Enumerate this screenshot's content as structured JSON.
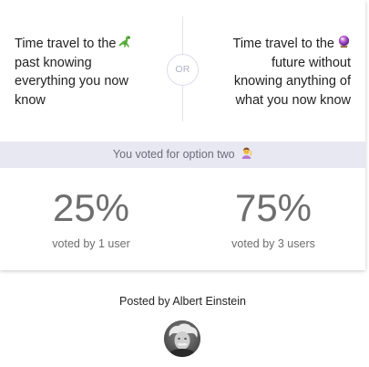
{
  "poll": {
    "option_one": {
      "text": "Time travel to the past knowing everything you now know",
      "emoji_icon": "dinosaur-icon"
    },
    "option_two": {
      "text": "Time travel to the future without knowing anything of what you now know",
      "emoji_icon": "crystal-ball-icon"
    },
    "or_label": "OR",
    "voted_message": "You voted for option two",
    "voted_emoji_icon": "person-raising-hand-icon"
  },
  "results": {
    "option_one": {
      "percent": "25%",
      "voters": "voted by 1 user",
      "share": 0.25
    },
    "option_two": {
      "percent": "75%",
      "voters": "voted by 3 users",
      "share": 0.75
    }
  },
  "author": {
    "posted_by": "Posted by Albert Einstein",
    "avatar_icon": "author-avatar"
  },
  "colors": {
    "voted_bar_bg": "#e8e8f3",
    "or_border": "#dcdced",
    "percent_text": "#6e6e6e"
  }
}
